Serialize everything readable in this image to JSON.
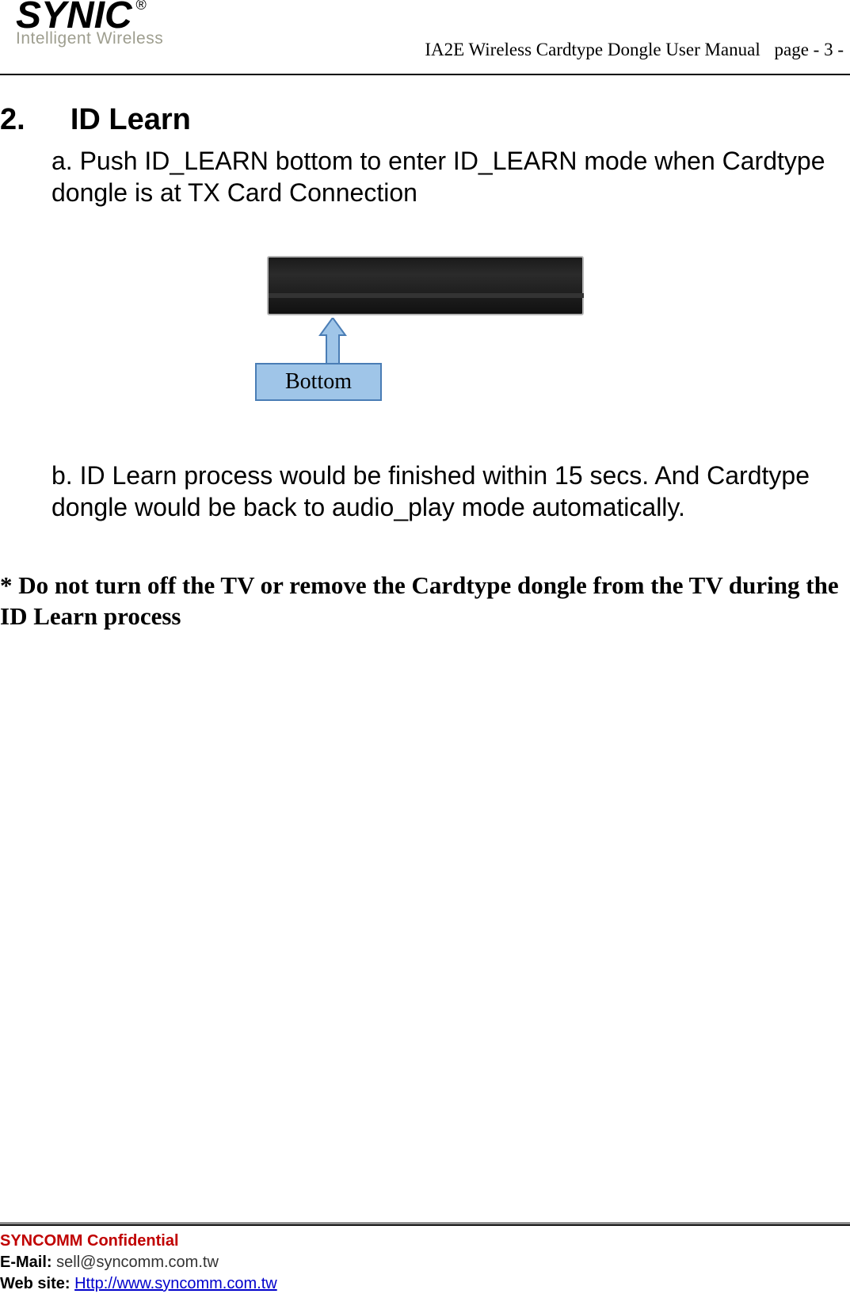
{
  "header": {
    "logo_main": "SYNIC",
    "logo_reg": "®",
    "logo_sub": "Intelligent Wireless",
    "doc_title": "IA2E Wireless Cardtype Dongle User Manual",
    "page_label": "page - 3 -"
  },
  "section": {
    "number": "2.",
    "title": "ID Learn",
    "step_a": "a. Push ID_LEARN bottom to enter ID_LEARN mode when Cardtype dongle is at TX Card Connection",
    "callout_label": "Bottom",
    "step_b": "b. ID Learn  process would be finished within 15 secs. And Cardtype dongle would be back to audio_play mode automatically.",
    "warning": "* Do not turn off the TV or remove the Cardtype dongle from the TV during the ID Learn process"
  },
  "footer": {
    "confidential": "SYNCOMM Confidential",
    "email_label": "E-Mail:",
    "email_value": "sell@syncomm.com.tw",
    "website_label": "Web site:",
    "website_value": "Http://www.syncomm.com.tw"
  }
}
